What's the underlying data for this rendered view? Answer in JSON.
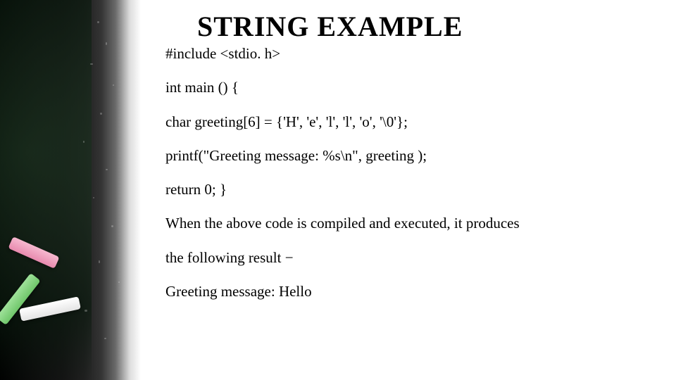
{
  "title": "STRING EXAMPLE",
  "code": {
    "l1": "#include <stdio. h>",
    "l2": "int main () {",
    "l3": "char greeting[6] = {'H', 'e', 'l', 'l', 'o', '\\0'};",
    "l4": "printf(\"Greeting message: %s\\n\", greeting );",
    "l5": " return 0; }"
  },
  "explain": {
    "l1": "When the above code is compiled and executed, it produces",
    "l2": "the following result −",
    "l3": "Greeting message: Hello"
  }
}
